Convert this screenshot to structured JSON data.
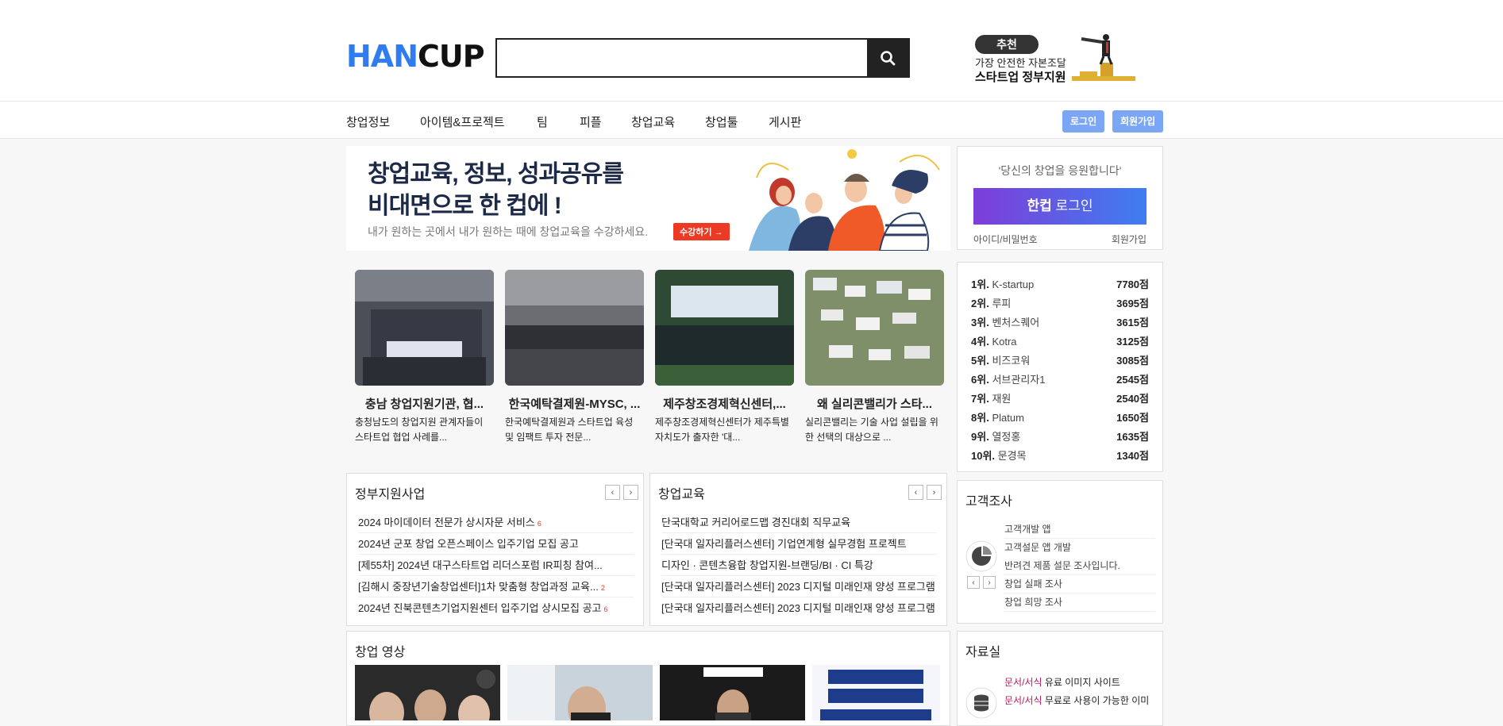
{
  "header": {
    "logo_han": "HAN",
    "logo_cup": "CUP",
    "search_placeholder": "",
    "promo": {
      "badge": "추천",
      "line1": "가장 안전한 자본조달",
      "line2": "스타트업 정부지원"
    }
  },
  "nav": {
    "items": [
      "창업정보",
      "아이템&프로젝트",
      "팀",
      "피플",
      "창업교육",
      "창업툴",
      "게시판"
    ],
    "login": "로그인",
    "signup": "회원가입"
  },
  "banner": {
    "title_line1": "창업교육, 정보, 성과공유를",
    "title_line2": "비대면으로 한 컵에 !",
    "subtitle": "내가 원하는 곳에서 내가 원하는 때에 창업교육을 수강하세요.",
    "button": "수강하기 →"
  },
  "cards": [
    {
      "title": "충남 창업지원기관, 협...",
      "desc": "충청남도의 창업지원 관계자들이 스타트업 협업 사례를..."
    },
    {
      "title": "한국예탁결제원-MYSC, ...",
      "desc": "한국예탁결제원과 스타트업 육성 및 임팩트 투자 전문..."
    },
    {
      "title": "제주창조경제혁신센터,...",
      "desc": "제주창조경제혁신센터가 제주특별자치도가 출자한 '대..."
    },
    {
      "title": "왜 실리콘밸리가 스타...",
      "desc": "실리콘밸리는 기술 사업 설립을 위한 선택의 대상으로 ..."
    }
  ],
  "gov_panel": {
    "title": "정부지원사업",
    "rows": [
      {
        "text": "2024 마이데이터 전문가 상시자문 서비스",
        "count": "6"
      },
      {
        "text": "2024년 군포 창업 오픈스페이스 입주기업 모집 공고",
        "count": ""
      },
      {
        "text": "[제55차] 2024년 대구스타트업 리더스포럼 IR피칭 참여...",
        "count": ""
      },
      {
        "text": "[김해시 중장년기술창업센터]1차 맞춤형 창업과정 교육...",
        "count": "2"
      },
      {
        "text": "2024년 진북콘텐츠기업지원센터 입주기업 상시모집 공고",
        "count": "6"
      }
    ]
  },
  "edu_panel": {
    "title": "창업교육",
    "rows": [
      {
        "text": "단국대학교 커리어로드맵 경진대회 직무교육",
        "count": ""
      },
      {
        "text": "[단국대 일자리플러스센터] 기업연계형 실무경험 프로젝트",
        "count": ""
      },
      {
        "text": "디자인 · 콘텐츠융합 창업지원-브랜딩/BI · CI 특강",
        "count": ""
      },
      {
        "text": "[단국대 일자리플러스센터] 2023 디지털 미래인재 양성 프로그램 -",
        "count": ""
      },
      {
        "text": "[단국대 일자리플러스센터] 2023 디지털 미래인재 양성 프로그램 -",
        "count": ""
      }
    ]
  },
  "video_panel": {
    "title": "창업 영상"
  },
  "login_box": {
    "message": "'당신의 창업을 응원합니다'",
    "button_brand": "한컵",
    "button_text": " 로그인",
    "find": "아이디/비밀번호",
    "signup": "회원가입"
  },
  "ranking": [
    {
      "pos": "1위.",
      "name": "K-startup",
      "points": "7780점"
    },
    {
      "pos": "2위.",
      "name": "루피",
      "points": "3695점"
    },
    {
      "pos": "3위.",
      "name": "벤처스퀘어",
      "points": "3615점"
    },
    {
      "pos": "4위.",
      "name": "Kotra",
      "points": "3125점"
    },
    {
      "pos": "5위.",
      "name": "비즈코워",
      "points": "3085점"
    },
    {
      "pos": "6위.",
      "name": "서브관리자1",
      "points": "2545점"
    },
    {
      "pos": "7위.",
      "name": "재원",
      "points": "2540점"
    },
    {
      "pos": "8위.",
      "name": "Platum",
      "points": "1650점"
    },
    {
      "pos": "9위.",
      "name": "열정홍",
      "points": "1635점"
    },
    {
      "pos": "10위.",
      "name": "문경목",
      "points": "1340점"
    }
  ],
  "survey": {
    "title": "고객조사",
    "items": [
      "고객개발 앱",
      "고객설문 앱 개발",
      "반려견 제품 설문 조사입니다.",
      "창업 실패 조사",
      "창업 희망 조사"
    ]
  },
  "data_room": {
    "title": "자료실",
    "items": [
      {
        "tag": "문서/서식",
        "text": " 유료 이미지 사이트"
      },
      {
        "tag": "문서/서식",
        "text": " 무료로 사용이 가능한 이미"
      }
    ]
  },
  "colors": {
    "accent": "#2f7bf0",
    "nav_button": "#7aa6f5",
    "banner_button": "#ec3a25",
    "count_red": "#e53935"
  }
}
